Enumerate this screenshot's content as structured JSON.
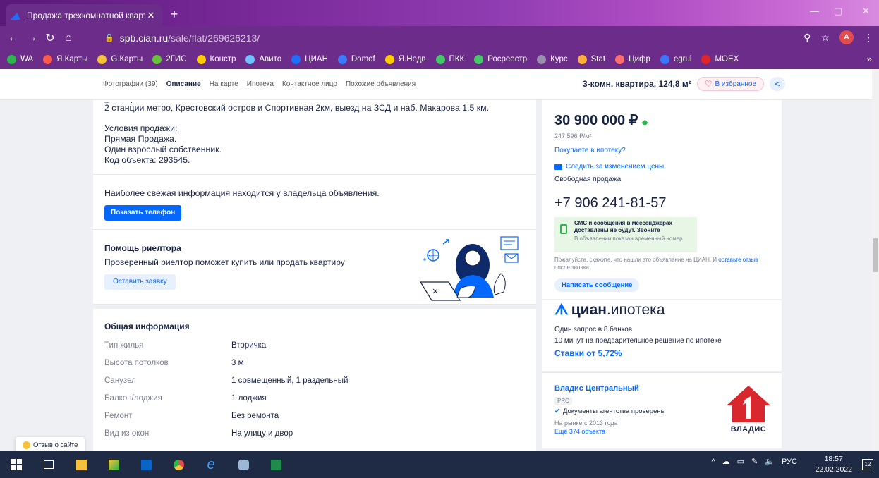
{
  "browser": {
    "tab_title": "Продажа трехкомнатной кварт",
    "tab_close": "✕",
    "new_tab": "+",
    "url_host": "spb.cian.ru",
    "url_path": "/sale/flat/269626213/",
    "profile_initial": "A",
    "bookmarks": [
      {
        "label": "WA",
        "color": "#2fb54d"
      },
      {
        "label": "Я.Карты",
        "color": "#ff5a4a"
      },
      {
        "label": "G.Карты",
        "color": "#f6c23b"
      },
      {
        "label": "2ГИС",
        "color": "#66c23b"
      },
      {
        "label": "Констр",
        "color": "#ffcc00"
      },
      {
        "label": "Авито",
        "color": "#6fc1ff"
      },
      {
        "label": "ЦИАН",
        "color": "#1f6fff"
      },
      {
        "label": "Domof",
        "color": "#3b7bff"
      },
      {
        "label": "Я.Недв",
        "color": "#ffcc00"
      },
      {
        "label": "ПКК",
        "color": "#46c76a"
      },
      {
        "label": "Росреестр",
        "color": "#46c76a"
      },
      {
        "label": "Курс",
        "color": "#9b8fb0"
      },
      {
        "label": "Stat",
        "color": "#ffae3b"
      },
      {
        "label": "Цифр",
        "color": "#ff6e6e"
      },
      {
        "label": "egrul",
        "color": "#3c78ff"
      },
      {
        "label": "MOEX",
        "color": "#e0242c"
      }
    ],
    "bookmarks_more": "»"
  },
  "subnav": {
    "links": [
      "Фотографии (39)",
      "Описание",
      "На карте",
      "Ипотека",
      "Контактное лицо",
      "Похожие объявления"
    ],
    "active_index": 1,
    "title": "3-комн. квартира, 124,8 м²",
    "favorite": "В избранное"
  },
  "description": {
    "cut_line": "Трансфер или дополнительно",
    "line1": "2 станции метро, Крестовский остров и Спортивная 2км, выезд на ЗСД и наб. Макарова 1,5 км.",
    "conditions_title": "Условия продажи:",
    "condition1": "Прямая Продажа.",
    "condition2": "Один взрослый собственник.",
    "code": "Код объекта:  293545."
  },
  "owner": {
    "text": "Наиболее свежая информация находится у владельца объявления.",
    "button": "Показать телефон"
  },
  "realtor": {
    "title": "Помощь риелтора",
    "subtitle": "Проверенный риелтор поможет купить или продать квартиру",
    "button": "Оставить заявку"
  },
  "general": {
    "title": "Общая информация",
    "rows": [
      {
        "k": "Тип жилья",
        "v": "Вторичка"
      },
      {
        "k": "Высота потолков",
        "v": "3 м"
      },
      {
        "k": "Санузел",
        "v": "1 совмещенный, 1 раздельный"
      },
      {
        "k": "Балкон/лоджия",
        "v": "1 лоджия"
      },
      {
        "k": "Ремонт",
        "v": "Без ремонта"
      },
      {
        "k": "Вид из окон",
        "v": "На улицу и двор"
      }
    ]
  },
  "price": {
    "value": "30 900 000 ₽",
    "per_meter": "247 596 ₽/м²",
    "mortgage_link": "Покупаете в ипотеку?",
    "track": "Следить за изменением цены",
    "sale_type": "Свободная продажа",
    "phone": "+7 906 241-81-57",
    "notice_bold": "СМС и сообщения в мессенджерах доставлены не будут. Звоните",
    "notice_gray": "В объявлении показан временный номер",
    "feedback_pre": "Пожалуйста, скажите, что нашли это объявление на ЦИАН. И ",
    "feedback_link": "оставьте отзыв",
    "feedback_post": " после звонка",
    "write_button": "Написать сообщение"
  },
  "cian": {
    "logo_main": "циан",
    "logo_sub": ".ипотека",
    "line1": "Один запрос в 8 банков",
    "line2": "10 минут на предварительное решение по ипотеке",
    "rates": "Ставки от 5,72%"
  },
  "agency": {
    "name": "Владис Центральный",
    "pro": "PRO",
    "checked": "Документы агентства проверены",
    "since": "На рынке с 2013 года",
    "more": "Ещё 374 объекта",
    "logo_word": "ВЛАДИС"
  },
  "site_feedback": "Отзыв о сайте",
  "taskbar": {
    "lang": "РУС",
    "time": "18:57",
    "date": "22.02.2022",
    "notif_count": "12"
  }
}
